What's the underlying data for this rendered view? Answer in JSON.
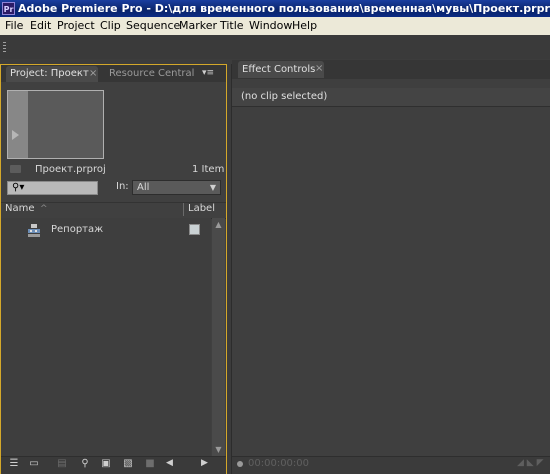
{
  "window": {
    "app_badge": "Pr",
    "title": "Adobe Premiere Pro - D:\\для временного пользования\\временная\\мувы\\Проект.prproj *"
  },
  "menubar": [
    "File",
    "Edit",
    "Project",
    "Clip",
    "Sequence",
    "Marker",
    "Title",
    "Window",
    "Help"
  ],
  "project_panel": {
    "tabs": {
      "project": "Project: Проект",
      "resource": "Resource Central",
      "close_glyph": "×",
      "menu_glyph": "▾≡"
    },
    "project_file": "Проект.prproj",
    "item_count": "1 Item",
    "search_glyph": "⚲▾",
    "in_label": "In:",
    "in_value": "All",
    "in_arrow": "▼",
    "columns": {
      "name": "Name",
      "label": "Label",
      "sort_glyph": "^"
    },
    "items": [
      {
        "name": "Репортаж",
        "type": "sequence",
        "label_color": "#c9d1d3"
      }
    ],
    "scroll_up_glyph": "▲",
    "scroll_down_glyph": "▼",
    "bottom_icons": [
      "list-view-icon",
      "icon-view-icon",
      "automate-to-sequence-icon",
      "find-icon",
      "new-bin-icon",
      "new-item-icon",
      "clear-icon"
    ],
    "bottom_glyphs": {
      "list": "☰",
      "iconview": "▭",
      "automate": "▤",
      "find": "⚲",
      "bin": "▣",
      "newitem": "▧",
      "clear": "■",
      "left": "◀",
      "right": "▶"
    }
  },
  "effect_controls_panel": {
    "tab": "Effect Controls",
    "close_glyph": "×",
    "message": "(no clip selected)",
    "timecode": "00:00:00:00",
    "bottom_right_glyph": "◢ ◣ ◤"
  },
  "colors": {
    "panel_focus_border": "#d4a82a",
    "titlebar": "#0a246a",
    "menubar": "#ece9d8",
    "panel_bg": "#404040"
  }
}
